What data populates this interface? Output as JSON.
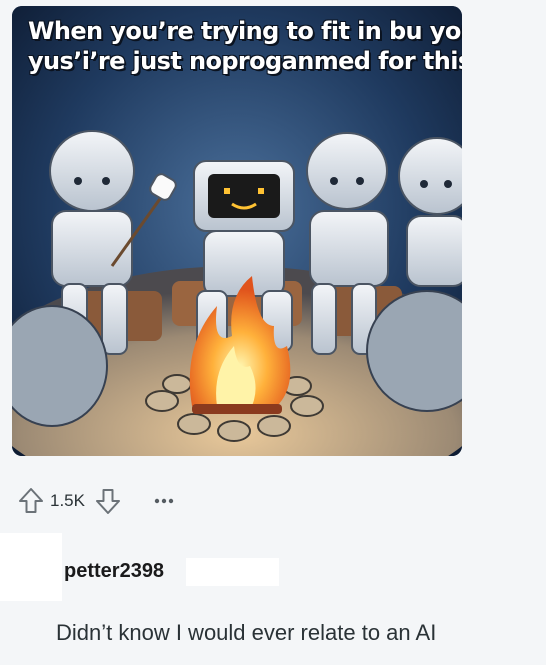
{
  "post": {
    "meme_caption_line1": "When you’re trying to fit in bu you’r",
    "meme_caption_line2": "yus’i’re just noproganmed for this."
  },
  "actions": {
    "upvote_icon": "arrow-up-outline-icon",
    "downvote_icon": "arrow-down-outline-icon",
    "score": "1.5K",
    "more_icon": "ellipsis-icon"
  },
  "comment": {
    "username": "petter2398",
    "body": "Didn’t know I would ever relate to an AI"
  },
  "colors": {
    "background": "#f4f6f8",
    "text": "#2a3236",
    "meme_sky": "#1d3556"
  }
}
